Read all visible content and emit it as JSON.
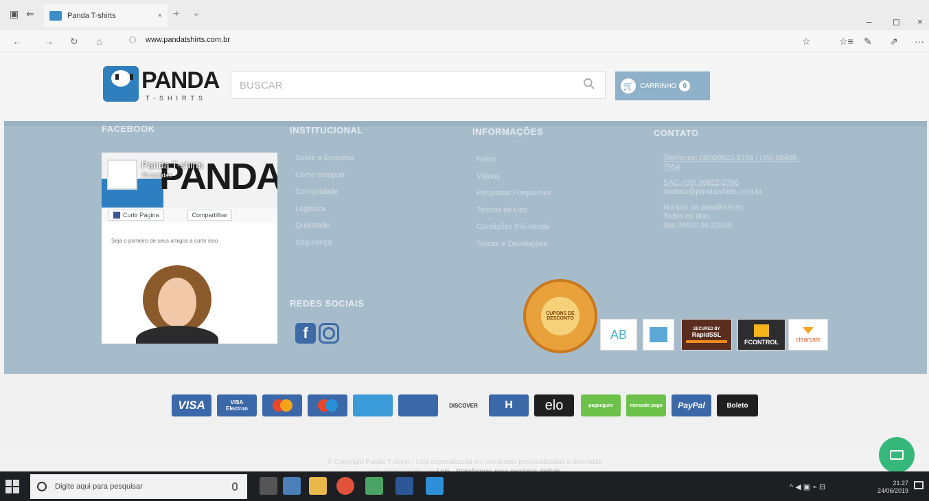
{
  "browser": {
    "tab_title": "Panda T-shirts",
    "tab_close": "×",
    "tab_new": "+",
    "tab_list": "⌄",
    "minimize": "–",
    "maximize": "◻",
    "close": "×",
    "back": "←",
    "forward": "→",
    "refresh": "↻",
    "home": "⌂",
    "url": "www.pandatshirts.com.br",
    "favorite": "☆",
    "favorites_hub": "☆≡",
    "notes": "✎",
    "share": "⇗",
    "more": "···"
  },
  "header": {
    "logo_text": "PANDA",
    "logo_sub": "T-SHIRTS",
    "search_placeholder": "BUSCAR",
    "cart_label": "CARRINHO",
    "cart_count": "0"
  },
  "footer": {
    "facebook_title": "FACEBOOK",
    "facebook_widget": {
      "page_name": "Panda T-shirts",
      "followers": "70 curtidas",
      "cover_text": "PANDA",
      "like_label": "Curtir Página",
      "share_label": "Compartilhar",
      "friends_text": "Seja o primeiro de seus amigos a curtir isso"
    },
    "institutional_title": "INSTITUCIONAL",
    "institutional_links": [
      "Sobre a Empresa",
      "Como comprar",
      "Comunidade",
      "Logística",
      "Qualidade",
      "Segurança"
    ],
    "info_title": "INFORMAÇÕES",
    "info_links": [
      "Fotos",
      "Vídeos",
      "Perguntas Frequentes",
      "Termos de Uso",
      "Condições Pré-venda",
      "Trocas e Devoluções"
    ],
    "contact_title": "CONTATO",
    "contact": {
      "phones": "Telefones: (35)99822-2766 / (35) 98408-7954",
      "sac": "SAC: (35) 99822-2766",
      "email": "contato@pandatshirts.com.br",
      "hours_title": "Horário de atendimento:",
      "hours_days": "Todos os dias",
      "hours_time": "das 08h00 às 22h00"
    },
    "social_title": "REDES SOCIAIS",
    "social_icons": [
      "facebook-icon",
      "instagram-icon"
    ],
    "seals": {
      "cupom": "CUPONS DE DESCONTO",
      "ab": "AB",
      "rapidssl": "RapidSSL",
      "rapidssl_top": "SECURED BY",
      "fcontrol": "FCONTROL",
      "clearsale": "clearsale"
    }
  },
  "payments": {
    "visa": "VISA",
    "visa_electron": "VISA",
    "visa_electron_sub": "Electron",
    "discover": "DISCOVER",
    "hipercard": "H",
    "elo": "elo",
    "pagseguro": "pagseguro",
    "mercadopago": "mercado pago",
    "paypal": "PayPal",
    "boleto": "Boleto"
  },
  "copyright": {
    "line1": "© Copyright Panda T-shirts - Loja especializada em camisetas personalizadas e divertidas",
    "line2_prefix": "Loja desenvolvida por",
    "line2_link": "Loja - Plataformas para negócios digitais"
  },
  "taskbar": {
    "search_placeholder": "Digite aqui para pesquisar",
    "time": "21:27",
    "date": "24/06/2019",
    "tray_symbols": "^ ◀ ▣ ⌁ ⊟"
  },
  "colors": {
    "footer_bg": "#a7bccb",
    "cart_bg": "#8fb1c9",
    "chat_button": "#36b87a"
  }
}
